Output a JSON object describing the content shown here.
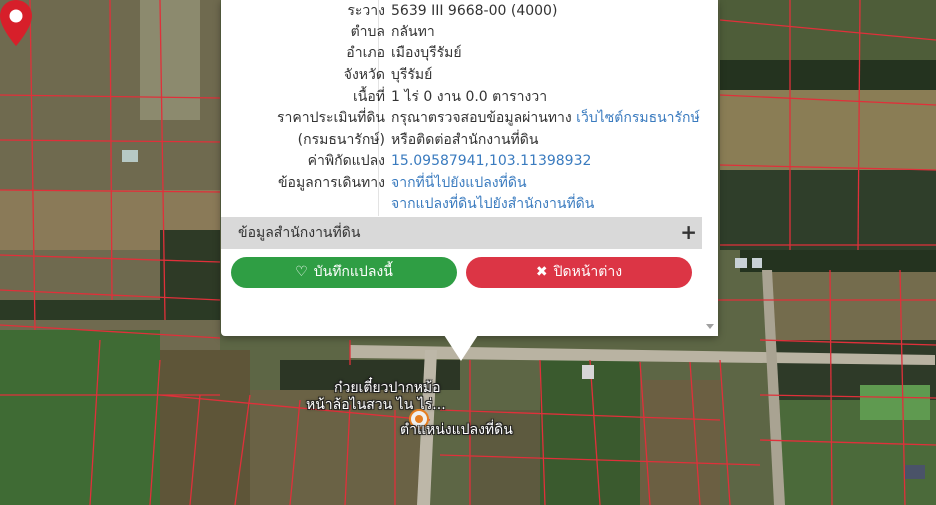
{
  "popup": {
    "rows": [
      {
        "key": "ระวาง",
        "value": "5639 III 9668-00 (4000)"
      },
      {
        "key": "ตำบล",
        "value": "กลันทา"
      },
      {
        "key": "อำเภอ",
        "value": "เมืองบุรีรัมย์"
      },
      {
        "key": "จังหวัด",
        "value": "บุรีรัมย์"
      },
      {
        "key": "เนื้อที่",
        "value": "1 ไร่ 0 งาน 0.0 ตารางวา"
      },
      {
        "key": "ราคาประเมินที่ดิน",
        "value": "กรุณาตรวจสอบข้อมูลผ่านทาง",
        "link": "เว็บไซต์กรมธนารักษ์"
      },
      {
        "key": "(กรมธนารักษ์)",
        "value": "หรือติดต่อสำนักงานที่ดิน"
      },
      {
        "key": "ค่าพิกัดแปลง",
        "value": "15.09587941,103.11398932"
      },
      {
        "key": "ข้อมูลการเดินทาง",
        "value": "จากที่นี่ไปยังแปลงที่ดิน"
      },
      {
        "key": "",
        "value": "จากแปลงที่ดินไปยังสำนักงานที่ดิน"
      }
    ],
    "section_title": "ข้อมูลสำนักงานที่ดิน",
    "section_expand_icon": "plus-icon",
    "save_label": "บันทึกแปลงนี้",
    "save_icon": "heart-icon",
    "close_label": "ปิดหน้าต่าง",
    "close_icon": "close-icon"
  },
  "map": {
    "poi_label_line1": "ก๋วยเตี๋ยวปากหม้อ",
    "poi_label_line2": "หน้าล้อไนสวน ไน ไร่...",
    "marker_label": "ตำแหน่งแปลงที่ดิน",
    "marker_icon": "map-pin-icon",
    "marker_color": "#d71f2a",
    "parcel_line_color": "#e0303a"
  }
}
